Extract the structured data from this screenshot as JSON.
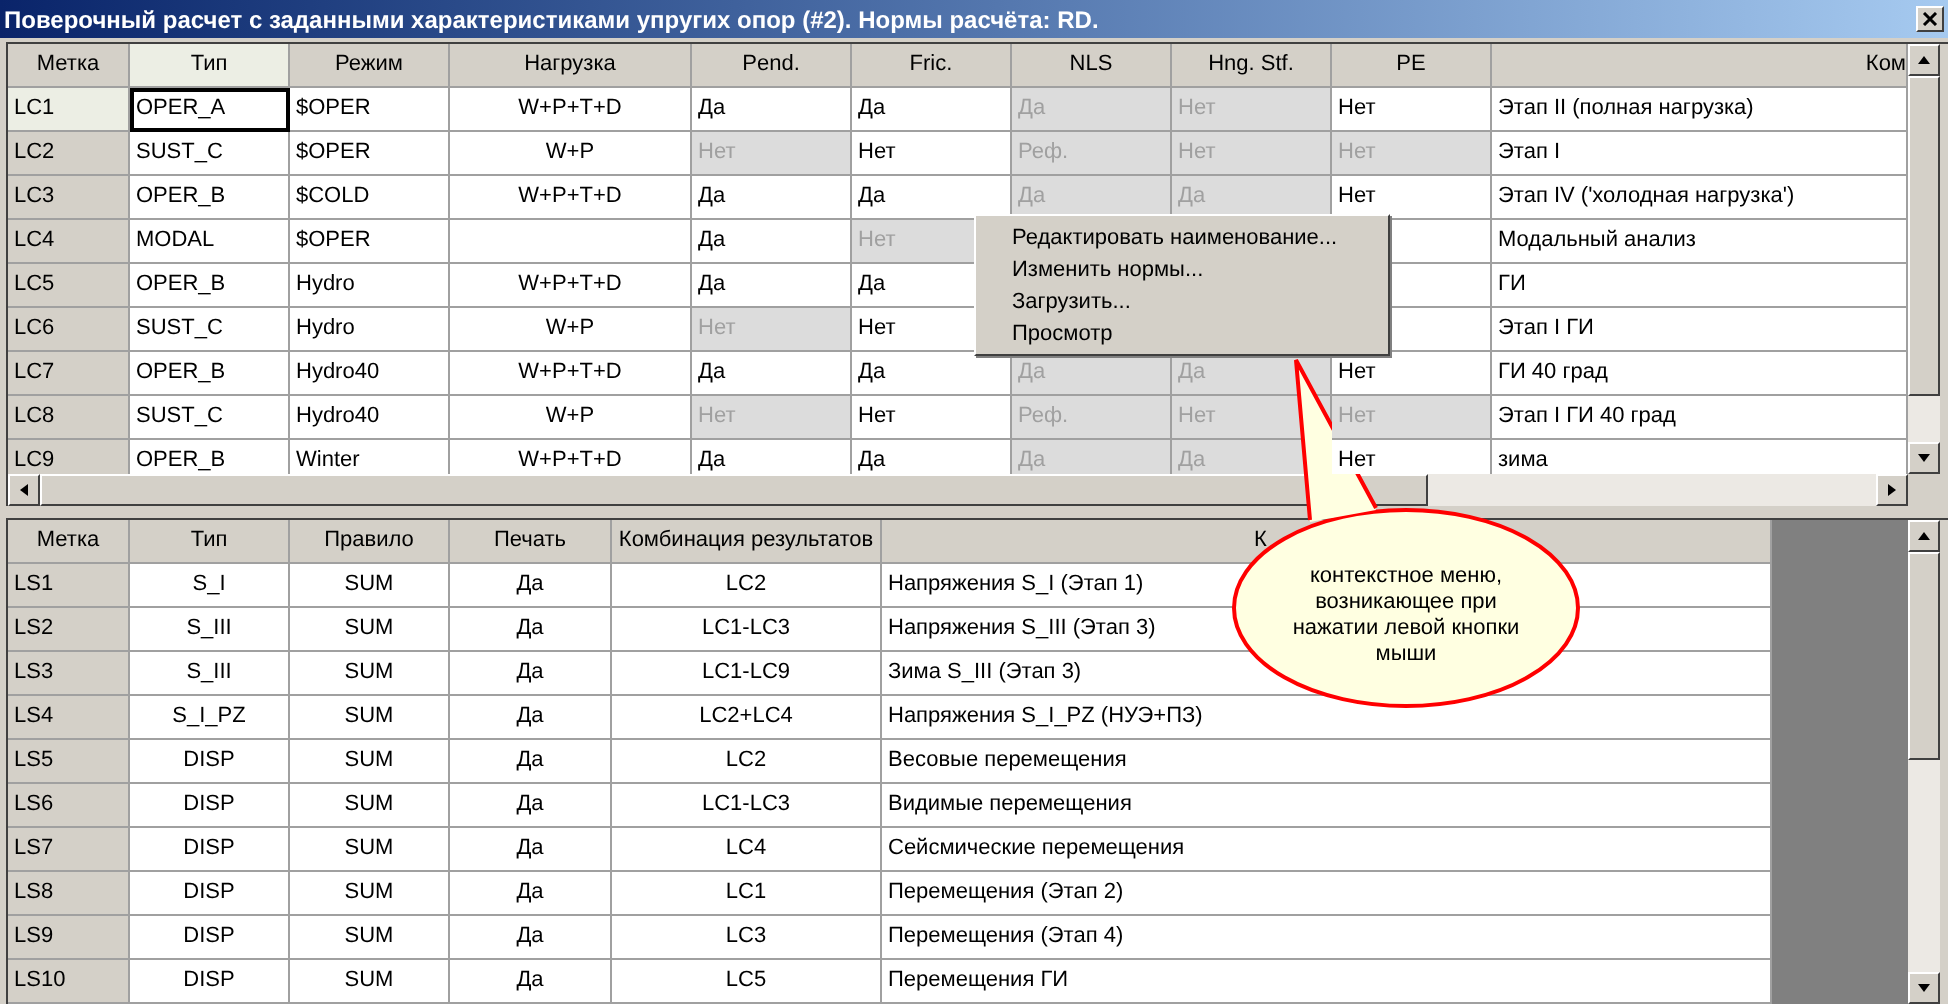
{
  "window": {
    "title": "Поверочный расчет с заданными характеристиками упругих опор (#2). Нормы расчёта: RD."
  },
  "top_table": {
    "columns": [
      {
        "label": "Метка",
        "selected": false
      },
      {
        "label": "Тип",
        "selected": true
      },
      {
        "label": "Режим",
        "selected": false
      },
      {
        "label": "Нагрузка",
        "selected": false
      },
      {
        "label": "Pend.",
        "selected": false
      },
      {
        "label": "Fric.",
        "selected": false
      },
      {
        "label": "NLS",
        "selected": false
      },
      {
        "label": "Hng. Stf.",
        "selected": false
      },
      {
        "label": "PE",
        "selected": false
      },
      {
        "label": "Ком",
        "selected": false
      }
    ],
    "rows": [
      {
        "selected": true,
        "cells": [
          {
            "text": "LC1",
            "disabled": false
          },
          {
            "text": "OPER_A",
            "disabled": false
          },
          {
            "text": "$OPER",
            "disabled": false
          },
          {
            "text": "W+P+T+D",
            "disabled": false
          },
          {
            "text": "Да",
            "disabled": false
          },
          {
            "text": "Да",
            "disabled": false
          },
          {
            "text": "Да",
            "disabled": true
          },
          {
            "text": "Нет",
            "disabled": true
          },
          {
            "text": "Нет",
            "disabled": false
          },
          {
            "text": "Этап II (полная нагрузка)",
            "disabled": false
          }
        ]
      },
      {
        "selected": false,
        "cells": [
          {
            "text": "LC2",
            "disabled": false
          },
          {
            "text": "SUST_C",
            "disabled": false
          },
          {
            "text": "$OPER",
            "disabled": false
          },
          {
            "text": "W+P",
            "disabled": false
          },
          {
            "text": "Нет",
            "disabled": true
          },
          {
            "text": "Нет",
            "disabled": false
          },
          {
            "text": "Реф.",
            "disabled": true
          },
          {
            "text": "Нет",
            "disabled": true
          },
          {
            "text": "Нет",
            "disabled": true
          },
          {
            "text": "Этап I",
            "disabled": false
          }
        ]
      },
      {
        "selected": false,
        "cells": [
          {
            "text": "LC3",
            "disabled": false
          },
          {
            "text": "OPER_B",
            "disabled": false
          },
          {
            "text": "$COLD",
            "disabled": false
          },
          {
            "text": "W+P+T+D",
            "disabled": false
          },
          {
            "text": "Да",
            "disabled": false
          },
          {
            "text": "Да",
            "disabled": false
          },
          {
            "text": "Да",
            "disabled": true
          },
          {
            "text": "Да",
            "disabled": true
          },
          {
            "text": "Нет",
            "disabled": false
          },
          {
            "text": "Этап IV ('холодная нагрузка')",
            "disabled": false
          }
        ]
      },
      {
        "selected": false,
        "cells": [
          {
            "text": "LC4",
            "disabled": false
          },
          {
            "text": "MODAL",
            "disabled": false
          },
          {
            "text": "$OPER",
            "disabled": false
          },
          null,
          {
            "text": "Да",
            "disabled": false
          },
          {
            "text": "Нет",
            "disabled": true
          },
          null,
          null,
          null,
          {
            "text": "Модальный анализ",
            "disabled": false
          }
        ]
      },
      {
        "selected": false,
        "cells": [
          {
            "text": "LC5",
            "disabled": false
          },
          {
            "text": "OPER_B",
            "disabled": false
          },
          {
            "text": "Hydro",
            "disabled": false
          },
          {
            "text": "W+P+T+D",
            "disabled": false
          },
          {
            "text": "Да",
            "disabled": false
          },
          {
            "text": "Да",
            "disabled": false
          },
          null,
          null,
          null,
          {
            "text": "ГИ",
            "disabled": false
          }
        ]
      },
      {
        "selected": false,
        "cells": [
          {
            "text": "LC6",
            "disabled": false
          },
          {
            "text": "SUST_C",
            "disabled": false
          },
          {
            "text": "Hydro",
            "disabled": false
          },
          {
            "text": "W+P",
            "disabled": false
          },
          {
            "text": "Нет",
            "disabled": true
          },
          {
            "text": "Нет",
            "disabled": false
          },
          null,
          null,
          null,
          {
            "text": "Этап I ГИ",
            "disabled": false
          }
        ]
      },
      {
        "selected": false,
        "cells": [
          {
            "text": "LC7",
            "disabled": false
          },
          {
            "text": "OPER_B",
            "disabled": false
          },
          {
            "text": "Hydro40",
            "disabled": false
          },
          {
            "text": "W+P+T+D",
            "disabled": false
          },
          {
            "text": "Да",
            "disabled": false
          },
          {
            "text": "Да",
            "disabled": false
          },
          {
            "text": "Да",
            "disabled": true
          },
          {
            "text": "Да",
            "disabled": true
          },
          {
            "text": "Нет",
            "disabled": false
          },
          {
            "text": "ГИ 40 град",
            "disabled": false
          }
        ]
      },
      {
        "selected": false,
        "cells": [
          {
            "text": "LC8",
            "disabled": false
          },
          {
            "text": "SUST_C",
            "disabled": false
          },
          {
            "text": "Hydro40",
            "disabled": false
          },
          {
            "text": "W+P",
            "disabled": false
          },
          {
            "text": "Нет",
            "disabled": true
          },
          {
            "text": "Нет",
            "disabled": false
          },
          {
            "text": "Реф.",
            "disabled": true
          },
          {
            "text": "Нет",
            "disabled": true
          },
          {
            "text": "Нет",
            "disabled": true
          },
          {
            "text": "Этап I ГИ 40 град",
            "disabled": false
          }
        ]
      },
      {
        "selected": false,
        "cells": [
          {
            "text": "LC9",
            "disabled": false
          },
          {
            "text": "OPER_B",
            "disabled": false
          },
          {
            "text": "Winter",
            "disabled": false
          },
          {
            "text": "W+P+T+D",
            "disabled": false
          },
          {
            "text": "Да",
            "disabled": false
          },
          {
            "text": "Да",
            "disabled": false
          },
          {
            "text": "Да",
            "disabled": true
          },
          {
            "text": "Да",
            "disabled": true
          },
          {
            "text": "Нет",
            "disabled": false
          },
          {
            "text": "зима",
            "disabled": false
          }
        ]
      }
    ]
  },
  "context_menu": {
    "items": [
      "Редактировать наименование...",
      "Изменить нормы...",
      "Загрузить...",
      "Просмотр"
    ]
  },
  "callout": {
    "text": "контекстное меню, возникающее при нажатии левой кнопки мыши"
  },
  "bottom_table": {
    "columns": [
      "Метка",
      "Тип",
      "Правило",
      "Печать",
      "Комбинация результатов",
      "К"
    ],
    "rows": [
      [
        "LS1",
        "S_I",
        "SUM",
        "Да",
        "LC2",
        "Напряжения S_I (Этап 1)"
      ],
      [
        "LS2",
        "S_III",
        "SUM",
        "Да",
        "LC1-LC3",
        "Напряжения S_III (Этап 3)"
      ],
      [
        "LS3",
        "S_III",
        "SUM",
        "Да",
        "LC1-LC9",
        "Зима S_III (Этап 3)"
      ],
      [
        "LS4",
        "S_I_PZ",
        "SUM",
        "Да",
        "LC2+LC4",
        "Напряжения S_I_PZ (НУЭ+ПЗ)"
      ],
      [
        "LS5",
        "DISP",
        "SUM",
        "Да",
        "LC2",
        "Весовые перемещения"
      ],
      [
        "LS6",
        "DISP",
        "SUM",
        "Да",
        "LC1-LC3",
        "Видимые перемещения"
      ],
      [
        "LS7",
        "DISP",
        "SUM",
        "Да",
        "LC4",
        "Сейсмические перемещения"
      ],
      [
        "LS8",
        "DISP",
        "SUM",
        "Да",
        "LC1",
        "Перемещения (Этап 2)"
      ],
      [
        "LS9",
        "DISP",
        "SUM",
        "Да",
        "LC3",
        "Перемещения (Этап 4)"
      ],
      [
        "LS10",
        "DISP",
        "SUM",
        "Да",
        "LC5",
        "Перемещения ГИ"
      ]
    ]
  }
}
